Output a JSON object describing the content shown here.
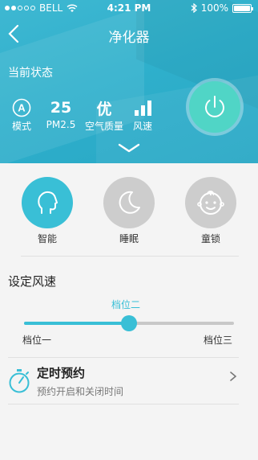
{
  "status_bar": {
    "carrier": "BELL",
    "time": "4:21 PM",
    "battery": "100%",
    "icons": [
      "signal-dots",
      "wifi-icon",
      "bluetooth-icon",
      "battery-icon"
    ]
  },
  "nav": {
    "title": "净化器",
    "back_icon": "back-chevron-icon"
  },
  "current_status": {
    "label": "当前状态",
    "stats": [
      {
        "value": "A",
        "label": "模式",
        "icon": "mode-a-icon"
      },
      {
        "value": "25",
        "label": "PM2.5"
      },
      {
        "value": "优",
        "label": "空气质量"
      },
      {
        "value": "",
        "label": "风速",
        "icon": "wind-bars-icon",
        "level": 3,
        "level_max": 3
      }
    ],
    "power_icon": "power-icon",
    "expand_icon": "chevron-down-icon"
  },
  "modes": [
    {
      "label": "智能",
      "icon": "head-profile-icon",
      "active": true
    },
    {
      "label": "睡眠",
      "icon": "moon-icon",
      "active": false
    },
    {
      "label": "童锁",
      "icon": "baby-face-icon",
      "active": false
    }
  ],
  "wind_speed": {
    "title": "设定风速",
    "current": "档位二",
    "min_label": "档位一",
    "max_label": "档位三",
    "level_fraction": 0.5
  },
  "timer": {
    "title": "定时预约",
    "subtitle": "预约开启和关闭时间",
    "icon": "stopwatch-icon",
    "chevron": "chevron-right-icon"
  },
  "colors": {
    "accent": "#39bfd6",
    "hero": "#2fb0cc",
    "power": "#50d5c6",
    "inactive": "#cdcdcd"
  }
}
